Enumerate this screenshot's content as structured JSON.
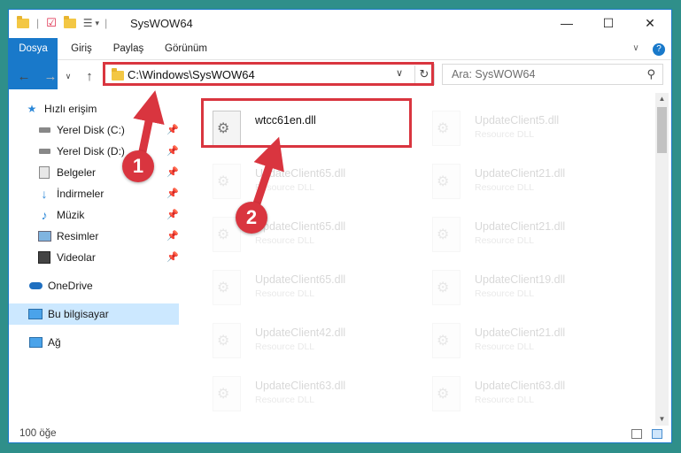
{
  "window": {
    "title": "SysWOW64"
  },
  "ribbon": {
    "tabs": [
      "Dosya",
      "Giriş",
      "Paylaş",
      "Görünüm"
    ]
  },
  "address": {
    "path": "C:\\Windows\\SysWOW64"
  },
  "search": {
    "placeholder": "Ara: SysWOW64"
  },
  "sidebar": {
    "quick_access": "Hızlı erişim",
    "items": [
      {
        "label": "Yerel Disk (C:)",
        "icon": "drive-icon",
        "pinned": true
      },
      {
        "label": "Yerel Disk (D:)",
        "icon": "drive-icon",
        "pinned": true
      },
      {
        "label": "Belgeler",
        "icon": "documents-icon",
        "pinned": true
      },
      {
        "label": "İndirmeler",
        "icon": "download-icon",
        "pinned": true
      },
      {
        "label": "Müzik",
        "icon": "music-icon",
        "pinned": true
      },
      {
        "label": "Resimler",
        "icon": "pictures-icon",
        "pinned": true
      },
      {
        "label": "Videolar",
        "icon": "videos-icon",
        "pinned": true
      }
    ],
    "onedrive": "OneDrive",
    "this_pc": "Bu bilgisayar",
    "network": "Ağ"
  },
  "files": [
    {
      "name": "wtcc61en.dll",
      "type": ""
    },
    {
      "name": "UpdateClient5.dll",
      "type": "Resource DLL"
    },
    {
      "name": "UpdateClient65.dll",
      "type": "Resource DLL"
    },
    {
      "name": "UpdateClient21.dll",
      "type": "Resource DLL"
    },
    {
      "name": "UpdateClient65.dll",
      "type": "Resource DLL"
    },
    {
      "name": "UpdateClient21.dll",
      "type": "Resource DLL"
    },
    {
      "name": "UpdateClient65.dll",
      "type": "Resource DLL"
    },
    {
      "name": "UpdateClient19.dll",
      "type": "Resource DLL"
    },
    {
      "name": "UpdateClient42.dll",
      "type": "Resource DLL"
    },
    {
      "name": "UpdateClient21.dll",
      "type": "Resource DLL"
    },
    {
      "name": "UpdateClient63.dll",
      "type": "Resource DLL"
    },
    {
      "name": "UpdateClient63.dll",
      "type": "Resource DLL"
    }
  ],
  "status": {
    "item_count": "100 öğe"
  },
  "annotations": {
    "step1": "1",
    "step2": "2"
  },
  "colors": {
    "accent": "#1979ca",
    "highlight": "#d9353f",
    "selected": "#cce8ff"
  }
}
